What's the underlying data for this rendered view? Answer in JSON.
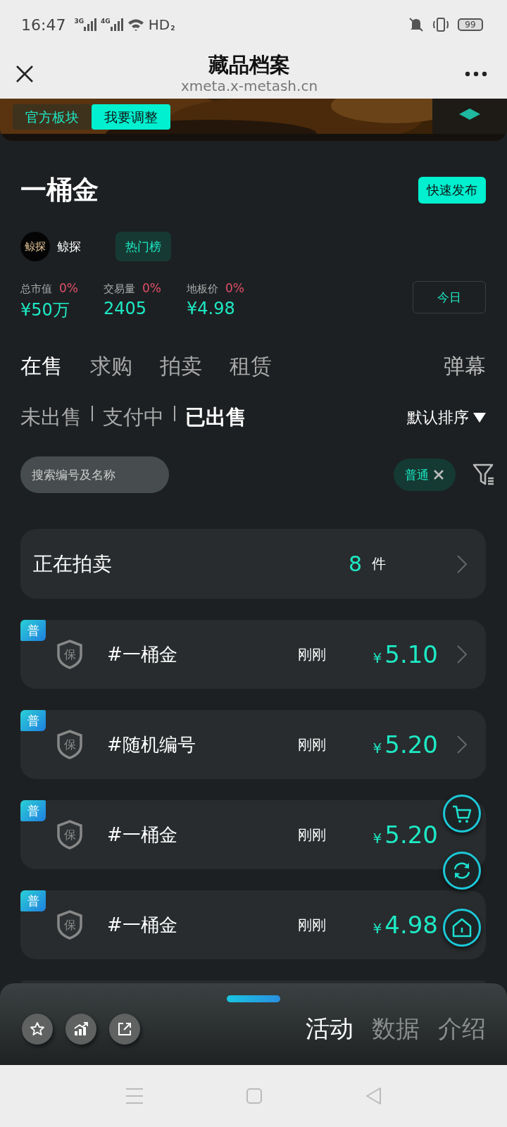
{
  "status_bar": {
    "time": "16:47",
    "signals": [
      {
        "label": "3G"
      },
      {
        "label": "4G"
      }
    ],
    "hd": "HD",
    "hd_sim": "2",
    "battery": "99"
  },
  "header": {
    "title": "藏品档案",
    "url": "xmeta.x-metash.cn"
  },
  "banner": {
    "kind": "picture",
    "tags": [
      {
        "label": "官方板块",
        "selected": false
      },
      {
        "label": "我要调整",
        "selected": true
      }
    ]
  },
  "collection": {
    "name": "一桶金",
    "publish_button": "快速发布",
    "publisher": {
      "logo_text": "鲸探",
      "name": "鲸探"
    },
    "rank_tag": "热门榜",
    "period_button": "今日",
    "stats": [
      {
        "label": "总市值",
        "change": "0%",
        "value": "¥50万"
      },
      {
        "label": "交易量",
        "change": "0%",
        "value": "2405"
      },
      {
        "label": "地板价",
        "change": "0%",
        "value": "¥4.98"
      }
    ]
  },
  "market_tabs": [
    {
      "label": "在售",
      "selected": true
    },
    {
      "label": "求购",
      "selected": false
    },
    {
      "label": "拍卖",
      "selected": false
    },
    {
      "label": "租赁",
      "selected": false
    }
  ],
  "danmaku": "弹幕",
  "status_tabs": [
    {
      "label": "未出售",
      "selected": false
    },
    {
      "label": "支付中",
      "selected": false
    },
    {
      "label": "已出售",
      "selected": true
    }
  ],
  "sort": "默认排序",
  "search": {
    "placeholder": "搜索编号及名称"
  },
  "filter_chip": {
    "label": "普通"
  },
  "auction": {
    "label": "正在拍卖",
    "count": "8",
    "unit": "件"
  },
  "items": [
    {
      "kind": "full",
      "badge": "普",
      "shield": "保",
      "name": "#一桶金",
      "time": "刚刚",
      "currency": "¥",
      "price": "5.10",
      "chevron": true
    },
    {
      "kind": "full",
      "badge": "普",
      "shield": "保",
      "name": "#随机编号",
      "time": "刚刚",
      "currency": "¥",
      "price": "5.20",
      "chevron": true
    },
    {
      "kind": "full",
      "badge": "普",
      "shield": "保",
      "name": "#一桶金",
      "time": "刚刚",
      "currency": "¥",
      "price": "5.20",
      "chevron": false
    },
    {
      "kind": "full",
      "badge": "普",
      "shield": "保",
      "name": "#一桶金",
      "time": "刚刚",
      "currency": "¥",
      "price": "4.98",
      "chevron": false
    },
    {
      "kind": "stub"
    }
  ],
  "sheet": {
    "tabs": [
      {
        "label": "活动",
        "selected": true
      },
      {
        "label": "数据",
        "selected": false
      },
      {
        "label": "介绍",
        "selected": false
      }
    ]
  }
}
